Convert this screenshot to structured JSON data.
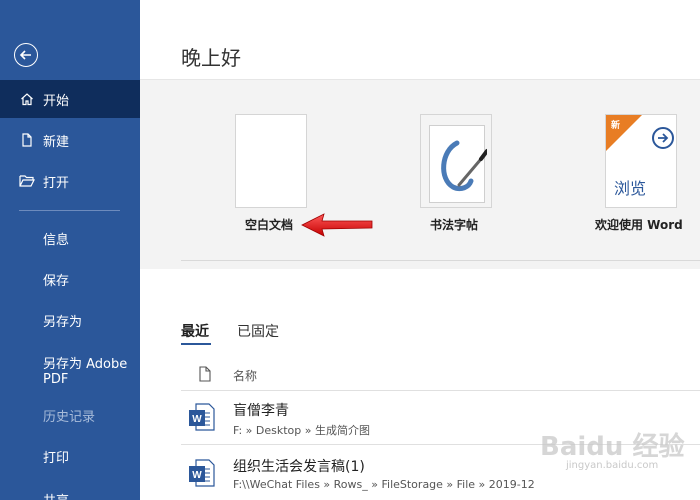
{
  "sidebar": {
    "items": [
      {
        "label": "开始"
      },
      {
        "label": "新建"
      },
      {
        "label": "打开"
      },
      {
        "label": "信息"
      },
      {
        "label": "保存"
      },
      {
        "label": "另存为"
      },
      {
        "label": "另存为 Adobe PDF"
      },
      {
        "label": "历史记录"
      },
      {
        "label": "打印"
      },
      {
        "label": "共享"
      }
    ],
    "bg_color": "#2b579a",
    "active_color": "#0f2d5c"
  },
  "main": {
    "greeting": "晚上好",
    "templates": [
      {
        "label": "空白文档"
      },
      {
        "label": "书法字帖"
      },
      {
        "label": "欢迎使用 Word",
        "badge": "新",
        "browse": "浏览"
      }
    ],
    "tabs": [
      {
        "label": "最近"
      },
      {
        "label": "已固定"
      }
    ],
    "list_header": "名称",
    "files": [
      {
        "name": "盲僧李青",
        "path": "F: » Desktop » 生成简介图"
      },
      {
        "name": "组织生活会发言稿(1)",
        "path": "F:\\\\WeChat Files » Rows_ » FileStorage » File » 2019-12"
      }
    ]
  },
  "watermark": {
    "main": "Baidu 经验",
    "sub": "jingyan.baidu.com"
  }
}
